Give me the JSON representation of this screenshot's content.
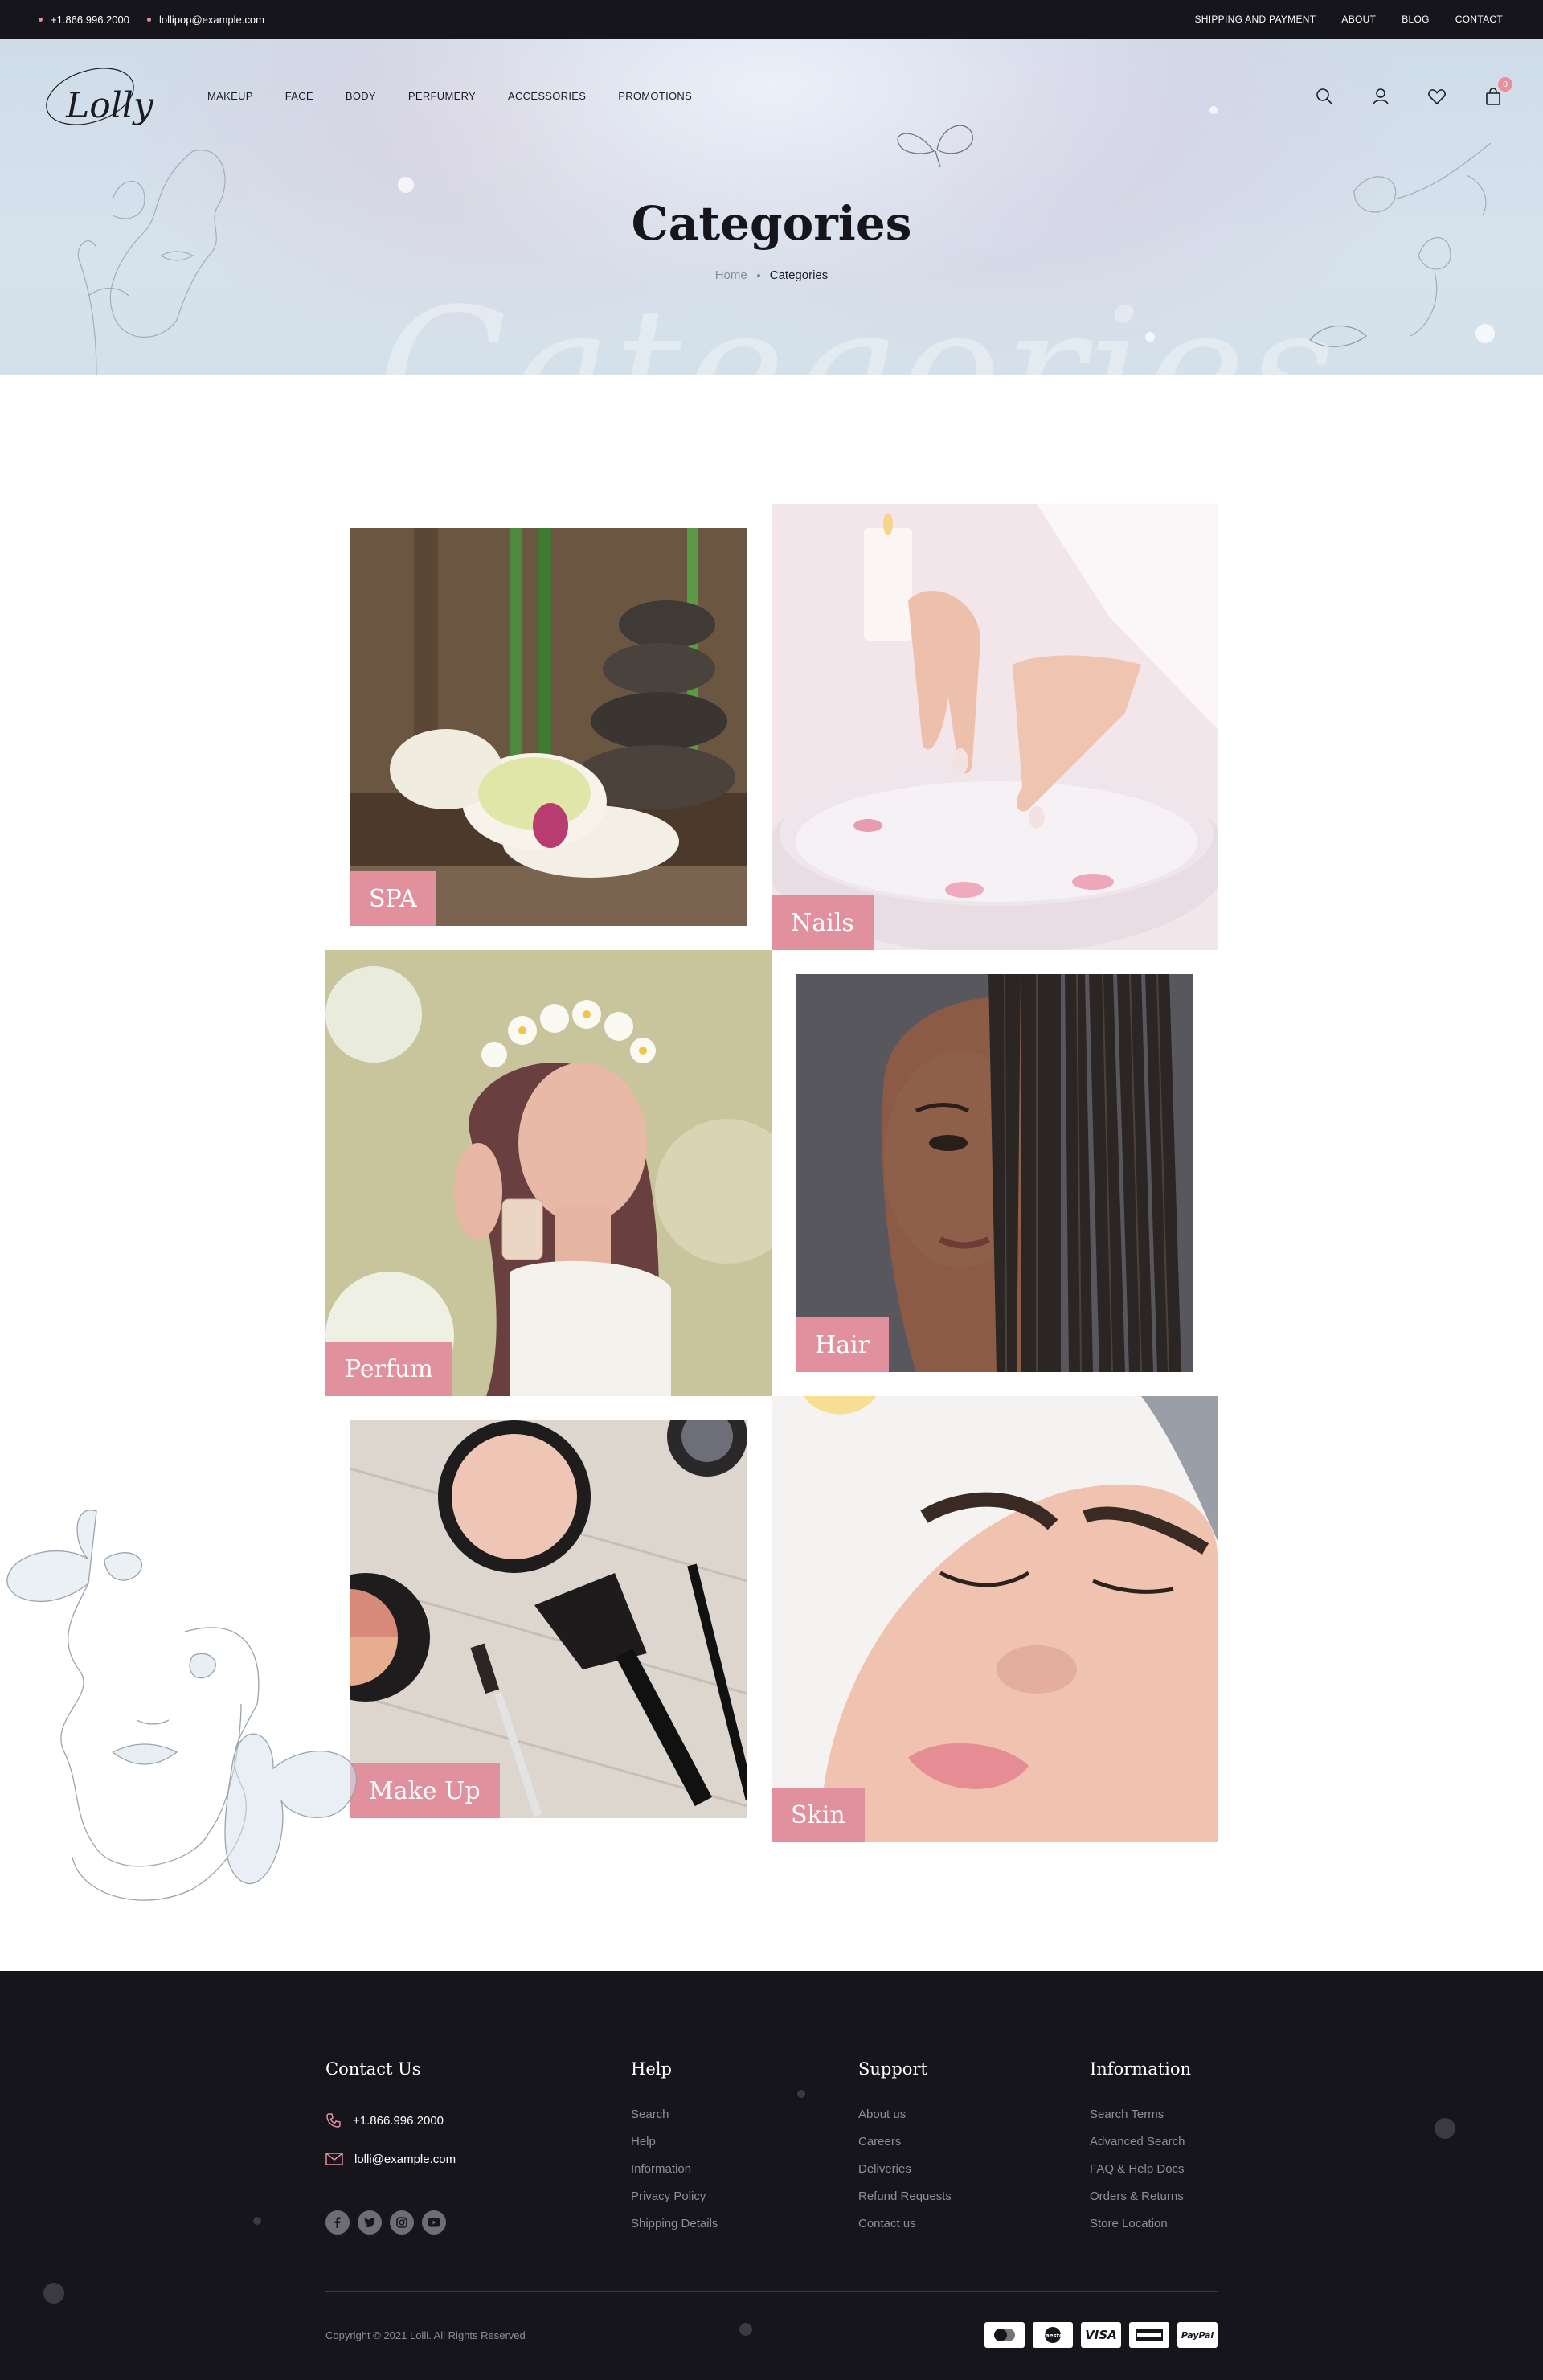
{
  "topbar": {
    "phone": "+1.866.996.2000",
    "email": "lollipop@example.com",
    "links": [
      "SHIPPING AND PAYMENT",
      "ABOUT",
      "BLOG",
      "CONTACT"
    ]
  },
  "header": {
    "logo_text": "Lolly",
    "nav": [
      "MAKEUP",
      "FACE",
      "BODY",
      "PERFUMERY",
      "ACCESSORIES",
      "PROMOTIONS"
    ],
    "icons": [
      "search-icon",
      "user-icon",
      "heart-icon",
      "cart-icon"
    ],
    "cart_count": "0"
  },
  "hero": {
    "title": "Categories",
    "watermark": "Categories",
    "breadcrumb": {
      "home": "Home",
      "current": "Categories"
    }
  },
  "categories": [
    {
      "label": "SPA"
    },
    {
      "label": "Nails"
    },
    {
      "label": "Perfum"
    },
    {
      "label": "Hair"
    },
    {
      "label": "Make Up"
    },
    {
      "label": "Skin"
    }
  ],
  "footer": {
    "contact": {
      "heading": "Contact Us",
      "phone": "+1.866.996.2000",
      "email": "lolli@example.com",
      "socials": [
        "facebook-icon",
        "twitter-icon",
        "instagram-icon",
        "youtube-icon"
      ]
    },
    "help": {
      "heading": "Help",
      "items": [
        "Search",
        "Help",
        "Information",
        "Privacy Policy",
        "Shipping Details"
      ]
    },
    "support": {
      "heading": "Support",
      "items": [
        "About us",
        "Careers",
        "Deliveries",
        "Refund Requests",
        "Contact us"
      ]
    },
    "information": {
      "heading": "Information",
      "items": [
        "Search Terms",
        "Advanced Search",
        "FAQ & Help Docs",
        "Orders & Returns",
        "Store Location"
      ]
    },
    "copyright": "Copyright © 2021 Lolli.  All Rights Reserved",
    "payments": [
      "MasterCard",
      "Maestro",
      "VISA",
      "AmEx",
      "PayPal"
    ]
  },
  "colors": {
    "accent": "#e0919d",
    "dark": "#16151c"
  }
}
